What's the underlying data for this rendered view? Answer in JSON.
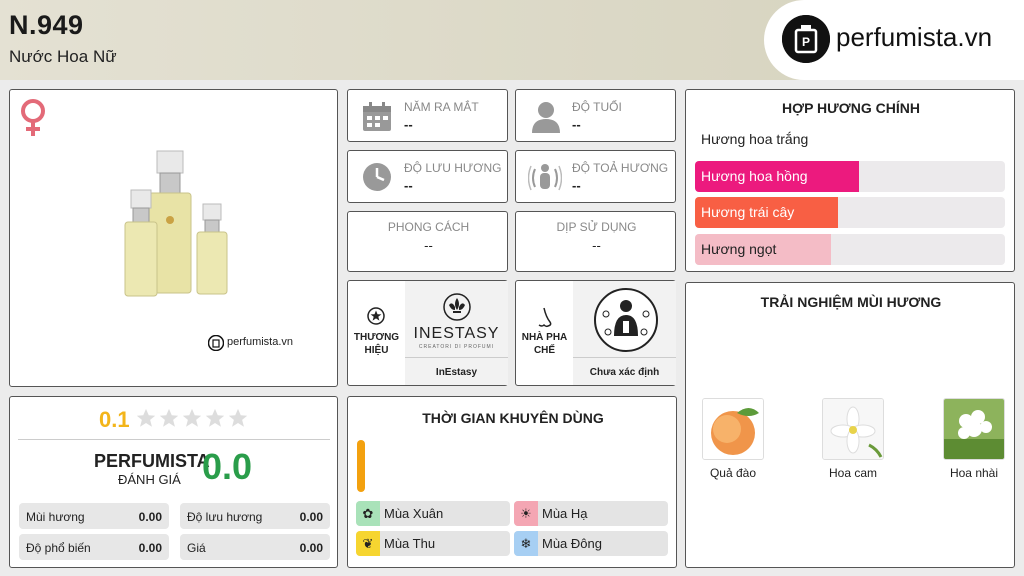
{
  "header": {
    "code": "N.949",
    "category": "Nước Hoa Nữ"
  },
  "brand_logo": {
    "text": "perfumista.vn"
  },
  "product": {
    "watermark": "perfumista.vn",
    "gender_icon": "female-symbol-icon"
  },
  "info": {
    "release_year": {
      "label": "NĂM RA MẮT",
      "value": "--"
    },
    "age": {
      "label": "ĐỘ TUỔI",
      "value": "--"
    },
    "longevity": {
      "label": "ĐỘ LƯU HƯƠNG",
      "value": "--"
    },
    "sillage": {
      "label": "ĐỘ TOẢ HƯƠNG",
      "value": "--"
    },
    "style": {
      "label": "PHONG CÁCH",
      "value": "--"
    },
    "occasion": {
      "label": "DỊP SỬ DỤNG",
      "value": "--"
    },
    "brand": {
      "label_1": "THƯƠNG",
      "label_2": "HIỆU",
      "name": "InEstasy",
      "logo_text": "INESTASY",
      "logo_sub": "CREATORI DI PROFUMI"
    },
    "perfumer": {
      "label_1": "NHÀ PHA",
      "label_2": "CHẾ",
      "name": "Chưa xác định"
    }
  },
  "accords": {
    "title": "HỢP HƯƠNG CHÍNH",
    "items": [
      {
        "name": "Hương hoa trắng",
        "level": 0,
        "color": "#ffffff"
      },
      {
        "name": "Hương hoa hồng",
        "level": 0.53,
        "color": "#ec1a7e"
      },
      {
        "name": "Hương trái cây",
        "level": 0.46,
        "color": "#f85f44"
      },
      {
        "name": "Hương ngọt",
        "level": 0.44,
        "color": "#f4bcc6"
      }
    ]
  },
  "rating": {
    "user_score": "0.1",
    "stars": 0,
    "brand_1": "PERFUMISTA",
    "brand_2": "ĐÁNH GIÁ",
    "score": "0.0",
    "metrics": [
      {
        "label": "Mùi hương",
        "value": "0.00"
      },
      {
        "label": "Độ lưu hương",
        "value": "0.00"
      },
      {
        "label": "Độ phổ biến",
        "value": "0.00"
      },
      {
        "label": "Giá",
        "value": "0.00"
      }
    ]
  },
  "recommend": {
    "title": "THỜI GIAN KHUYÊN DÙNG",
    "seasons": [
      {
        "name": "Mùa Xuân",
        "color": "#a9e2b9",
        "icon": "flower-icon"
      },
      {
        "name": "Mùa Hạ",
        "color": "#f4a6b3",
        "icon": "sun-icon"
      },
      {
        "name": "Mùa Thu",
        "color": "#f6d530",
        "icon": "leaf-icon"
      },
      {
        "name": "Mùa Đông",
        "color": "#a7cff3",
        "icon": "snowflake-icon"
      }
    ],
    "accent_color": "#f3a10f"
  },
  "experience": {
    "title": "TRẢI NGHIỆM MÙI HƯƠNG",
    "notes": [
      {
        "name": "Quả đào"
      },
      {
        "name": "Hoa cam"
      },
      {
        "name": "Hoa nhài"
      }
    ]
  }
}
